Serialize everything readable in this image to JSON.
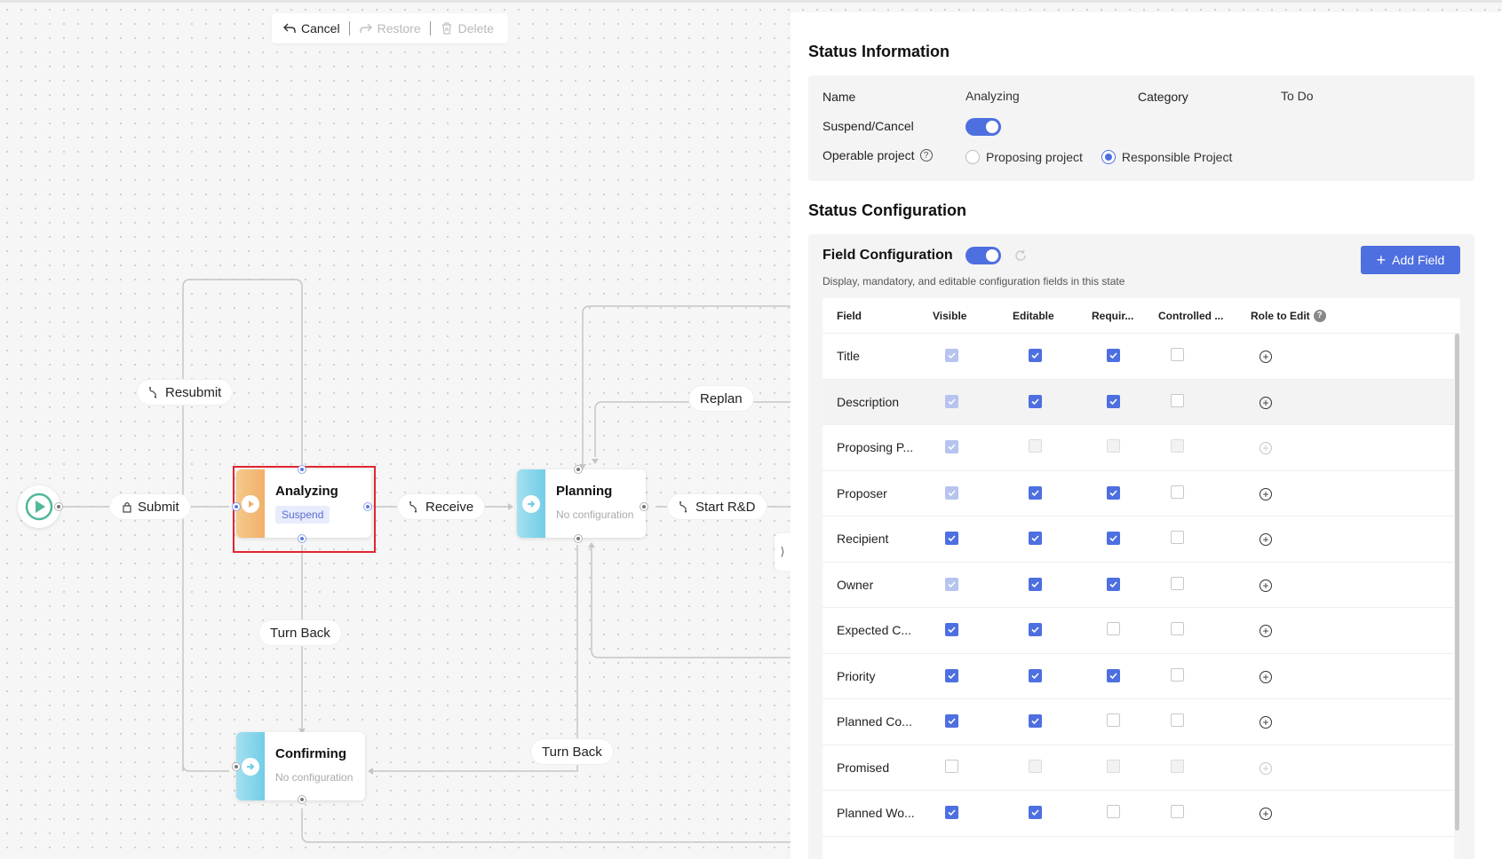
{
  "toolbar": {
    "cancel": "Cancel",
    "restore": "Restore",
    "delete": "Delete"
  },
  "flow": {
    "nodes": {
      "analyzing": {
        "title": "Analyzing",
        "badge": "Suspend"
      },
      "planning": {
        "title": "Planning",
        "subtitle": "No configuration"
      },
      "confirming": {
        "title": "Confirming",
        "subtitle": "No configuration"
      }
    },
    "edges": {
      "submit": "Submit",
      "resubmit": "Resubmit",
      "receive": "Receive",
      "start_rd": "Start R&D",
      "replan": "Replan",
      "turn_back_1": "Turn Back",
      "turn_back_2": "Turn Back"
    }
  },
  "status_info": {
    "title": "Status Information",
    "name_label": "Name",
    "name_value": "Analyzing",
    "category_label": "Category",
    "category_value": "To Do",
    "suspend_label": "Suspend/Cancel",
    "suspend_on": true,
    "operable_label": "Operable project",
    "option_proposing": "Proposing project",
    "option_responsible": "Responsible Project",
    "selected_option": "Responsible Project"
  },
  "status_config": {
    "title": "Status Configuration",
    "field_config_title": "Field Configuration",
    "field_config_on": true,
    "description": "Display, mandatory, and editable configuration fields in this state",
    "add_field_label": "Add Field",
    "columns": [
      "Field",
      "Visible",
      "Editable",
      "Requir...",
      "Controlled ...",
      "Role to Edit"
    ],
    "rows": [
      {
        "field": "Title",
        "visible": "on-dis",
        "editable": "on",
        "required": "on",
        "controlled": "off",
        "role": "active"
      },
      {
        "field": "Description",
        "visible": "on-dis",
        "editable": "on",
        "required": "on",
        "controlled": "off",
        "role": "active"
      },
      {
        "field": "Proposing P...",
        "visible": "on-dis",
        "editable": "off-dis",
        "required": "off-dis",
        "controlled": "off-dis",
        "role": "disabled"
      },
      {
        "field": "Proposer",
        "visible": "on-dis",
        "editable": "on",
        "required": "on",
        "controlled": "off",
        "role": "active"
      },
      {
        "field": "Recipient",
        "visible": "on",
        "editable": "on",
        "required": "on",
        "controlled": "off",
        "role": "active"
      },
      {
        "field": "Owner",
        "visible": "on-dis",
        "editable": "on",
        "required": "on",
        "controlled": "off",
        "role": "active"
      },
      {
        "field": "Expected C...",
        "visible": "on",
        "editable": "on",
        "required": "off",
        "controlled": "off",
        "role": "active"
      },
      {
        "field": "Priority",
        "visible": "on",
        "editable": "on",
        "required": "on",
        "controlled": "off",
        "role": "active"
      },
      {
        "field": "Planned Co...",
        "visible": "on",
        "editable": "on",
        "required": "off",
        "controlled": "off",
        "role": "active"
      },
      {
        "field": "Promised",
        "visible": "off",
        "editable": "off-dis",
        "required": "off-dis",
        "controlled": "off-dis",
        "role": "disabled"
      },
      {
        "field": "Planned Wo...",
        "visible": "on",
        "editable": "on",
        "required": "off",
        "controlled": "off",
        "role": "active"
      }
    ]
  },
  "colors": {
    "accent": "#4e6fe0",
    "selection": "#e0262f",
    "node_orange": "#f1b06a",
    "node_blue": "#72cde6",
    "start_green": "#4fb89a"
  }
}
